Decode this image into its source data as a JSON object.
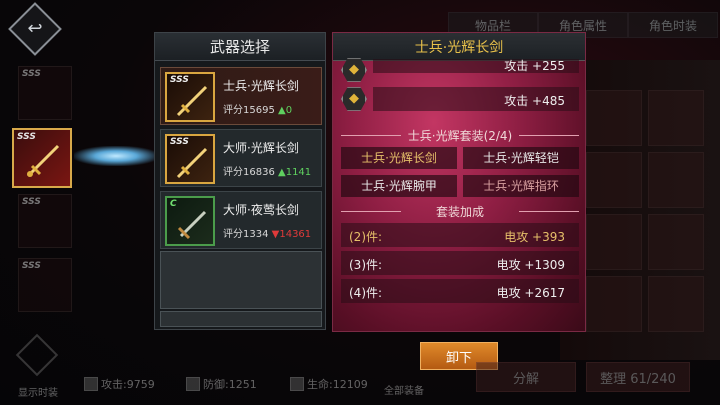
{
  "top_tabs": [
    "物品栏",
    "角色属性",
    "角色时装"
  ],
  "left_slots": [
    {
      "grade": "SSS"
    },
    {
      "grade": "SSS"
    },
    {
      "grade": "SSS"
    },
    {
      "grade": "SSS"
    }
  ],
  "weapon_panel": {
    "title": "武器选择",
    "items": [
      {
        "grade": "SSS",
        "name": "士兵·光辉长剑",
        "score_label": "评分15695",
        "delta": "0",
        "trend": "up"
      },
      {
        "grade": "SSS",
        "name": "大师·光辉长剑",
        "score_label": "评分16836",
        "delta": "1141",
        "trend": "up"
      },
      {
        "grade": "C",
        "name": "大师·夜莺长剑",
        "score_label": "评分1334",
        "delta": "14361",
        "trend": "down"
      }
    ]
  },
  "detail_panel": {
    "title": "士兵·光辉长剑",
    "stats": [
      {
        "label": "攻击 +255"
      },
      {
        "label": "攻击 +485"
      }
    ],
    "set_title": "士兵·光辉套装(2/4)",
    "set_items": [
      {
        "name": "士兵·光辉长剑",
        "owned": true
      },
      {
        "name": "士兵·光辉轻铠",
        "owned": false
      },
      {
        "name": "士兵·光辉腕甲",
        "owned": false
      },
      {
        "name": "士兵·光辉指环",
        "owned": true
      }
    ],
    "bonus_title": "套装加成",
    "bonuses": [
      {
        "pieces": "(2)件:",
        "effect": "电攻 +393",
        "active": true
      },
      {
        "pieces": "(3)件:",
        "effect": "电攻 +1309",
        "active": false
      },
      {
        "pieces": "(4)件:",
        "effect": "电攻 +2617",
        "active": false
      }
    ],
    "unload_label": "卸下"
  },
  "bottom": {
    "show_fashion": "显示时装",
    "attack": "攻击:9759",
    "defense": "防御:1251",
    "life": "生命:12109",
    "all_equip": "全部装备",
    "decompose": "分解",
    "organize": "整理 61/240"
  },
  "colors": {
    "gold": "#e7c04a",
    "up": "#5fd05f",
    "down": "#e03a3a",
    "panel_red": "#8e1e43"
  }
}
